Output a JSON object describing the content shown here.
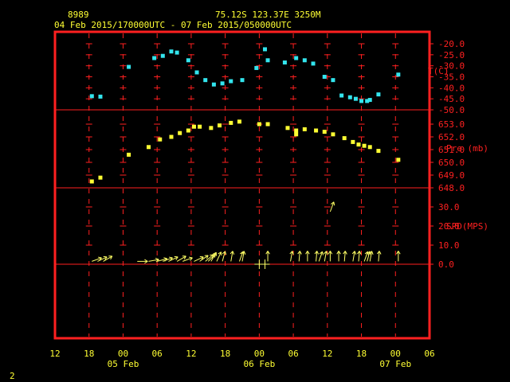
{
  "header": {
    "station_id": "8989",
    "location": "75.12S   123.37E   3250M",
    "time_range": "04 Feb 2015/170000UTC - 07 Feb 2015/050000UTC"
  },
  "footer": {
    "page_number": "2"
  },
  "colors": {
    "frame": "#ff2020",
    "header_text": "#ffff33",
    "temperature": "#33e5ee",
    "pressure": "#ffff33",
    "wind": "#ffff66",
    "grid": "#ff2020"
  },
  "x_axis": {
    "ticks": [
      {
        "hour": 12,
        "label": "12"
      },
      {
        "hour": 18,
        "label": "18"
      },
      {
        "hour": 24,
        "label": "00"
      },
      {
        "hour": 30,
        "label": "06"
      },
      {
        "hour": 36,
        "label": "12"
      },
      {
        "hour": 42,
        "label": "18"
      },
      {
        "hour": 48,
        "label": "00"
      },
      {
        "hour": 54,
        "label": "06"
      },
      {
        "hour": 60,
        "label": "12"
      },
      {
        "hour": 66,
        "label": "18"
      },
      {
        "hour": 72,
        "label": "00"
      },
      {
        "hour": 78,
        "label": "06"
      }
    ],
    "date_labels": [
      {
        "hour": 24,
        "label": "05 Feb"
      },
      {
        "hour": 48,
        "label": "06 Feb"
      },
      {
        "hour": 72,
        "label": "07 Feb"
      }
    ]
  },
  "chart_data": [
    {
      "type": "scatter",
      "name": "temperature",
      "ylabel": "T(C)",
      "ylim": [
        -50,
        -20
      ],
      "ytick_labels": [
        "-20.0",
        "-25.0",
        "-30.0",
        "-35.0",
        "-40.0",
        "-45.0",
        "-50.0"
      ],
      "ytick_values": [
        -20,
        -25,
        -30,
        -35,
        -40,
        -45,
        -50
      ],
      "x_unit": "hours since 04 Feb 2015 00 UTC",
      "points": [
        [
          18.5,
          -43.8
        ],
        [
          20,
          -44
        ],
        [
          25,
          -30.5
        ],
        [
          29.5,
          -26.5
        ],
        [
          31,
          -25.5
        ],
        [
          32.5,
          -23.5
        ],
        [
          33.5,
          -24
        ],
        [
          35.5,
          -27.5
        ],
        [
          37,
          -33
        ],
        [
          38.5,
          -36.5
        ],
        [
          40,
          -38.5
        ],
        [
          41.5,
          -38
        ],
        [
          43,
          -37
        ],
        [
          45,
          -36.5
        ],
        [
          47.5,
          -31
        ],
        [
          49,
          -22.5
        ],
        [
          49.5,
          -27.5
        ],
        [
          52.5,
          -28.5
        ],
        [
          54.5,
          -26.5
        ],
        [
          56,
          -27.5
        ],
        [
          57.5,
          -29
        ],
        [
          59.5,
          -35
        ],
        [
          61,
          -36.5
        ],
        [
          62.5,
          -43.5
        ],
        [
          64,
          -44.3
        ],
        [
          65,
          -45
        ],
        [
          66,
          -46
        ],
        [
          67,
          -46
        ],
        [
          67.5,
          -45.5
        ],
        [
          69,
          -43
        ],
        [
          72.5,
          -34
        ]
      ]
    },
    {
      "type": "scatter",
      "name": "pressure",
      "ylabel": "Pre (mb)",
      "ylim": [
        648,
        653
      ],
      "ytick_labels": [
        "653.0",
        "652.0",
        "651.0",
        "650.0",
        "649.0",
        "648.0"
      ],
      "ytick_values": [
        653,
        652,
        651,
        650,
        649,
        648
      ],
      "x_unit": "hours since 04 Feb 2015 00 UTC",
      "points": [
        [
          18.5,
          648.5
        ],
        [
          20,
          648.8
        ],
        [
          25,
          650.6
        ],
        [
          28.5,
          651.2
        ],
        [
          30.5,
          651.8
        ],
        [
          32.5,
          652.0
        ],
        [
          34,
          652.3
        ],
        [
          35.5,
          652.5
        ],
        [
          36.5,
          652.8
        ],
        [
          37.5,
          652.8
        ],
        [
          39.5,
          652.7
        ],
        [
          41,
          652.9
        ],
        [
          43,
          653.1
        ],
        [
          44.5,
          653.2
        ],
        [
          48,
          653.0
        ],
        [
          49.5,
          653.0
        ],
        [
          53,
          652.7
        ],
        [
          54.5,
          652.5
        ],
        [
          54.5,
          652.2
        ],
        [
          56,
          652.6
        ],
        [
          58,
          652.5
        ],
        [
          59.5,
          652.4
        ],
        [
          61,
          652.2
        ],
        [
          63,
          651.9
        ],
        [
          64.5,
          651.6
        ],
        [
          65.5,
          651.4
        ],
        [
          66.5,
          651.3
        ],
        [
          67.5,
          651.2
        ],
        [
          69,
          650.9
        ],
        [
          72.5,
          650.2
        ]
      ]
    },
    {
      "type": "scatter",
      "name": "wind",
      "ylabel": "SPD(MPS)",
      "ylim": [
        0,
        30
      ],
      "ytick_labels": [
        "30.0",
        "20.0",
        "10.0",
        "0.0"
      ],
      "ytick_values": [
        30,
        20,
        10,
        0
      ],
      "x_unit": "hours since 04 Feb 2015 00 UTC",
      "points": [
        [
          18.5,
          4,
          70
        ],
        [
          19.5,
          4,
          65
        ],
        [
          20.5,
          4,
          60
        ],
        [
          26.5,
          4,
          90
        ],
        [
          28.5,
          4,
          80
        ],
        [
          30,
          4,
          75
        ],
        [
          31,
          4,
          70
        ],
        [
          32,
          4,
          65
        ],
        [
          33.5,
          4,
          60
        ],
        [
          34.5,
          4,
          70
        ],
        [
          36.5,
          4,
          65
        ],
        [
          37.5,
          4,
          55
        ],
        [
          38.5,
          4,
          50
        ],
        [
          39,
          4,
          45
        ],
        [
          39.5,
          4,
          30
        ],
        [
          40.5,
          4,
          25
        ],
        [
          41.5,
          4,
          15
        ],
        [
          43,
          4,
          10
        ],
        [
          44.5,
          4,
          20
        ],
        [
          45,
          4,
          10
        ],
        [
          48,
          0,
          0
        ],
        [
          49,
          0,
          0
        ],
        [
          49.5,
          4,
          0
        ],
        [
          53.5,
          4,
          10
        ],
        [
          55,
          4,
          5
        ],
        [
          56.5,
          4,
          0
        ],
        [
          58,
          4,
          5
        ],
        [
          58.5,
          4,
          20
        ],
        [
          59.5,
          4,
          10
        ],
        [
          60.5,
          4,
          0
        ],
        [
          62,
          4,
          0
        ],
        [
          63,
          4,
          5
        ],
        [
          64.5,
          4,
          10
        ],
        [
          65.5,
          4,
          5
        ],
        [
          66.5,
          4,
          20
        ],
        [
          67,
          4,
          15
        ],
        [
          67.5,
          4,
          10
        ],
        [
          69,
          4,
          5
        ],
        [
          72.5,
          4,
          0
        ],
        [
          60.5,
          30,
          20
        ]
      ]
    }
  ]
}
